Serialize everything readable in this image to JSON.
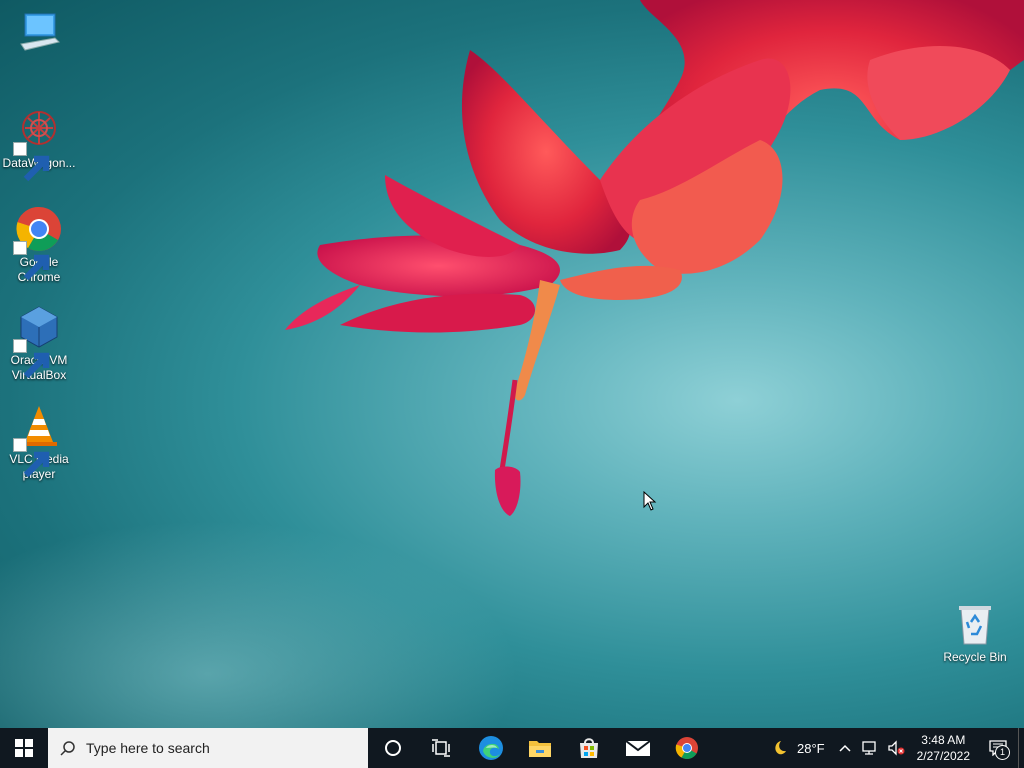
{
  "desktop_icons": [
    {
      "label": "",
      "icon": "computer-icon"
    },
    {
      "label": "DataWagon...",
      "icon": "datawagon-icon"
    },
    {
      "label": "Google Chrome",
      "icon": "chrome-icon"
    },
    {
      "label": "Oracle VM VirtualBox",
      "icon": "virtualbox-icon"
    },
    {
      "label": "VLC media player",
      "icon": "vlc-icon"
    },
    {
      "label": "Recycle Bin",
      "icon": "recycle-bin-icon"
    }
  ],
  "taskbar": {
    "search_placeholder": "Type here to search",
    "pinned": [
      "cortana-icon",
      "task-view-icon",
      "edge-icon",
      "file-explorer-icon",
      "store-icon",
      "mail-icon",
      "chrome-icon"
    ],
    "weather": {
      "temp": "28°F",
      "icon": "moon-icon"
    },
    "clock": {
      "time": "3:48 AM",
      "date": "2/27/2022"
    },
    "notifications_count": "1"
  },
  "colors": {
    "taskbar": "#101820",
    "accent": "#0078d7"
  }
}
